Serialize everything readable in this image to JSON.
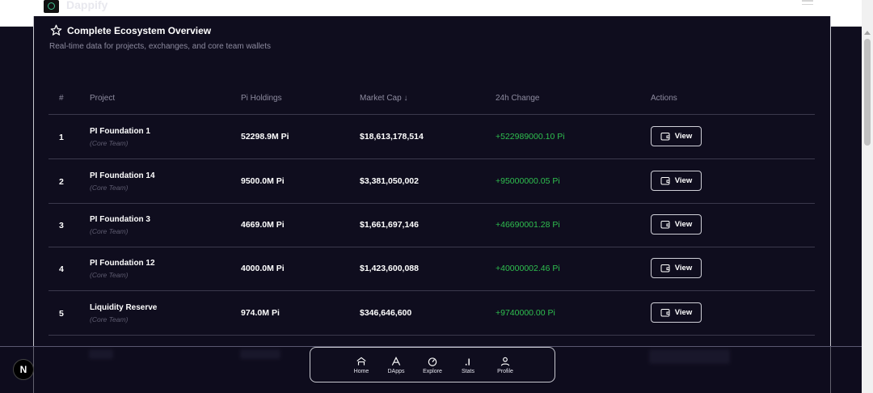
{
  "header": {
    "app_title": "Dappify"
  },
  "card": {
    "title": "Complete Ecosystem Overview",
    "subtitle": "Real-time data for projects, exchanges, and core team wallets"
  },
  "table": {
    "columns": [
      "#",
      "Project",
      "Pi Holdings",
      "Market Cap ↓",
      "24h Change",
      "Actions"
    ],
    "rows": [
      {
        "rank": "1",
        "name": "PI Foundation 1",
        "tag": "(Core Team)",
        "holdings": "52298.9M Pi",
        "market_cap": "$18,613,178,514",
        "change": "+522989000.10 Pi",
        "action": "View"
      },
      {
        "rank": "2",
        "name": "PI Foundation 14",
        "tag": "(Core Team)",
        "holdings": "9500.0M Pi",
        "market_cap": "$3,381,050,002",
        "change": "+95000000.05 Pi",
        "action": "View"
      },
      {
        "rank": "3",
        "name": "PI Foundation 3",
        "tag": "(Core Team)",
        "holdings": "4669.0M Pi",
        "market_cap": "$1,661,697,146",
        "change": "+46690001.28 Pi",
        "action": "View"
      },
      {
        "rank": "4",
        "name": "PI Foundation 12",
        "tag": "(Core Team)",
        "holdings": "4000.0M Pi",
        "market_cap": "$1,423,600,088",
        "change": "+40000002.46 Pi",
        "action": "View"
      },
      {
        "rank": "5",
        "name": "Liquidity Reserve",
        "tag": "(Core Team)",
        "holdings": "974.0M Pi",
        "market_cap": "$346,646,600",
        "change": "+9740000.00 Pi",
        "action": "View"
      }
    ]
  },
  "nav": {
    "items": [
      {
        "label": "Home",
        "icon": "home-icon"
      },
      {
        "label": "DApps",
        "icon": "dapps-icon"
      },
      {
        "label": "Explore",
        "icon": "explore-icon"
      },
      {
        "label": "Stats",
        "icon": "stats-icon"
      },
      {
        "label": "Profile",
        "icon": "profile-icon"
      }
    ]
  },
  "badge": {
    "letter": "N"
  },
  "colors": {
    "background": "#0f0d1e",
    "positive": "#2fbf4f",
    "muted": "#8e8ca0"
  }
}
